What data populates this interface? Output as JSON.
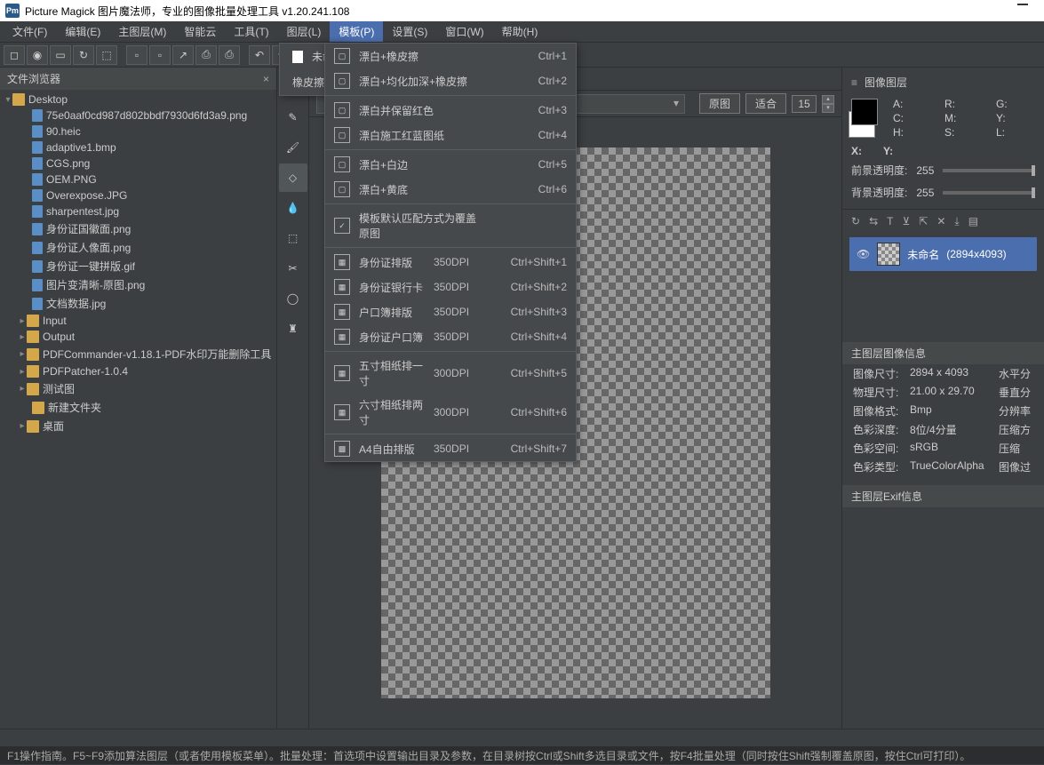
{
  "title": "Picture Magick 图片魔法师，专业的图像批量处理工具 v1.20.241.108",
  "menubar": [
    "文件(F)",
    "编辑(E)",
    "主图层(M)",
    "智能云",
    "工具(T)",
    "图层(L)",
    "模板(P)",
    "设置(S)",
    "窗口(W)",
    "帮助(H)"
  ],
  "active_menu_index": 6,
  "popup_items": [
    "未命",
    "橡皮擦"
  ],
  "submenu": {
    "g1": [
      {
        "label": "漂白+橡皮擦",
        "sc": "Ctrl+1"
      },
      {
        "label": "漂白+均化加深+橡皮擦",
        "sc": "Ctrl+2"
      }
    ],
    "g2": [
      {
        "label": "漂白并保留红色",
        "sc": "Ctrl+3"
      },
      {
        "label": "漂白施工红蓝图纸",
        "sc": "Ctrl+4"
      }
    ],
    "g3": [
      {
        "label": "漂白+白边",
        "sc": "Ctrl+5"
      },
      {
        "label": "漂白+黄底",
        "sc": "Ctrl+6"
      }
    ],
    "g4": [
      {
        "label": "模板默认匹配方式为覆盖原图",
        "check": true
      }
    ],
    "g5": [
      {
        "label": "身份证排版",
        "dpi": "350DPI",
        "sc": "Ctrl+Shift+1"
      },
      {
        "label": "身份证银行卡",
        "dpi": "350DPI",
        "sc": "Ctrl+Shift+2"
      },
      {
        "label": "户口簿排版",
        "dpi": "350DPI",
        "sc": "Ctrl+Shift+3"
      },
      {
        "label": "身份证户口簿",
        "dpi": "350DPI",
        "sc": "Ctrl+Shift+4"
      }
    ],
    "g6": [
      {
        "label": "五寸相纸排一寸",
        "dpi": "300DPI",
        "sc": "Ctrl+Shift+5"
      },
      {
        "label": "六寸相纸排两寸",
        "dpi": "300DPI",
        "sc": "Ctrl+Shift+6"
      }
    ],
    "g7": [
      {
        "label": "A4自由排版",
        "dpi": "350DPI",
        "sc": "Ctrl+Shift+7"
      }
    ]
  },
  "filebrowser": {
    "title": "文件浏览器",
    "root": "Desktop",
    "files": [
      "75e0aaf0cd987d802bbdf7930d6fd3a9.png",
      "90.heic",
      "adaptive1.bmp",
      "CGS.png",
      "OEM.PNG",
      "Overexpose.JPG",
      "sharpentest.jpg",
      "身份证国徽面.png",
      "身份证人像面.png",
      "身份证一键拼版.gif",
      "图片变清晰-原图.png",
      "文档数据.jpg"
    ],
    "folders": [
      "Input",
      "Output",
      "PDFCommander-v1.18.1-PDF水印万能删除工具",
      "PDFPatcher-1.0.4",
      "测试图",
      "新建文件夹",
      "桌面"
    ]
  },
  "tab_label": "未命",
  "ctrl": {
    "orig": "原图",
    "fit": "适合",
    "zoom": "15"
  },
  "right": {
    "title": "图像图层",
    "coords": {
      "A": "A:",
      "R": "R:",
      "G": "G:",
      "C": "C:",
      "M": "M:",
      "Y": "Y:",
      "H": "H:",
      "S": "S:",
      "L": "L:",
      "X": "X:",
      "Yc": "Y:"
    },
    "fg": "前景透明度:",
    "bg": "背景透明度:",
    "fgval": "255",
    "bgval": "255",
    "layer_name": "未命名",
    "layer_size": "(2894x4093)",
    "info_title": "主图层图像信息",
    "info": [
      {
        "k": "图像尺寸:",
        "v": "2894 x 4093",
        "k2": "水平分"
      },
      {
        "k": "物理尺寸:",
        "v": "21.00 x 29.70",
        "k2": "垂直分"
      },
      {
        "k": "图像格式:",
        "v": "Bmp",
        "k2": "分辨率"
      },
      {
        "k": "色彩深度:",
        "v": "8位/4分量",
        "k2": "压缩方"
      },
      {
        "k": "色彩空间:",
        "v": "sRGB",
        "k2": "压缩"
      },
      {
        "k": "色彩类型:",
        "v": "TrueColorAlpha",
        "k2": "图像过"
      }
    ],
    "exif_title": "主图层Exif信息"
  },
  "hint": "F1操作指南。F5~F9添加算法图层（或者使用模板菜单）。批量处理：首选项中设置输出目录及参数，在目录树按Ctrl或Shift多选目录或文件，按F4批量处理（同时按住Shift强制覆盖原图，按住Ctrl可打印）。"
}
